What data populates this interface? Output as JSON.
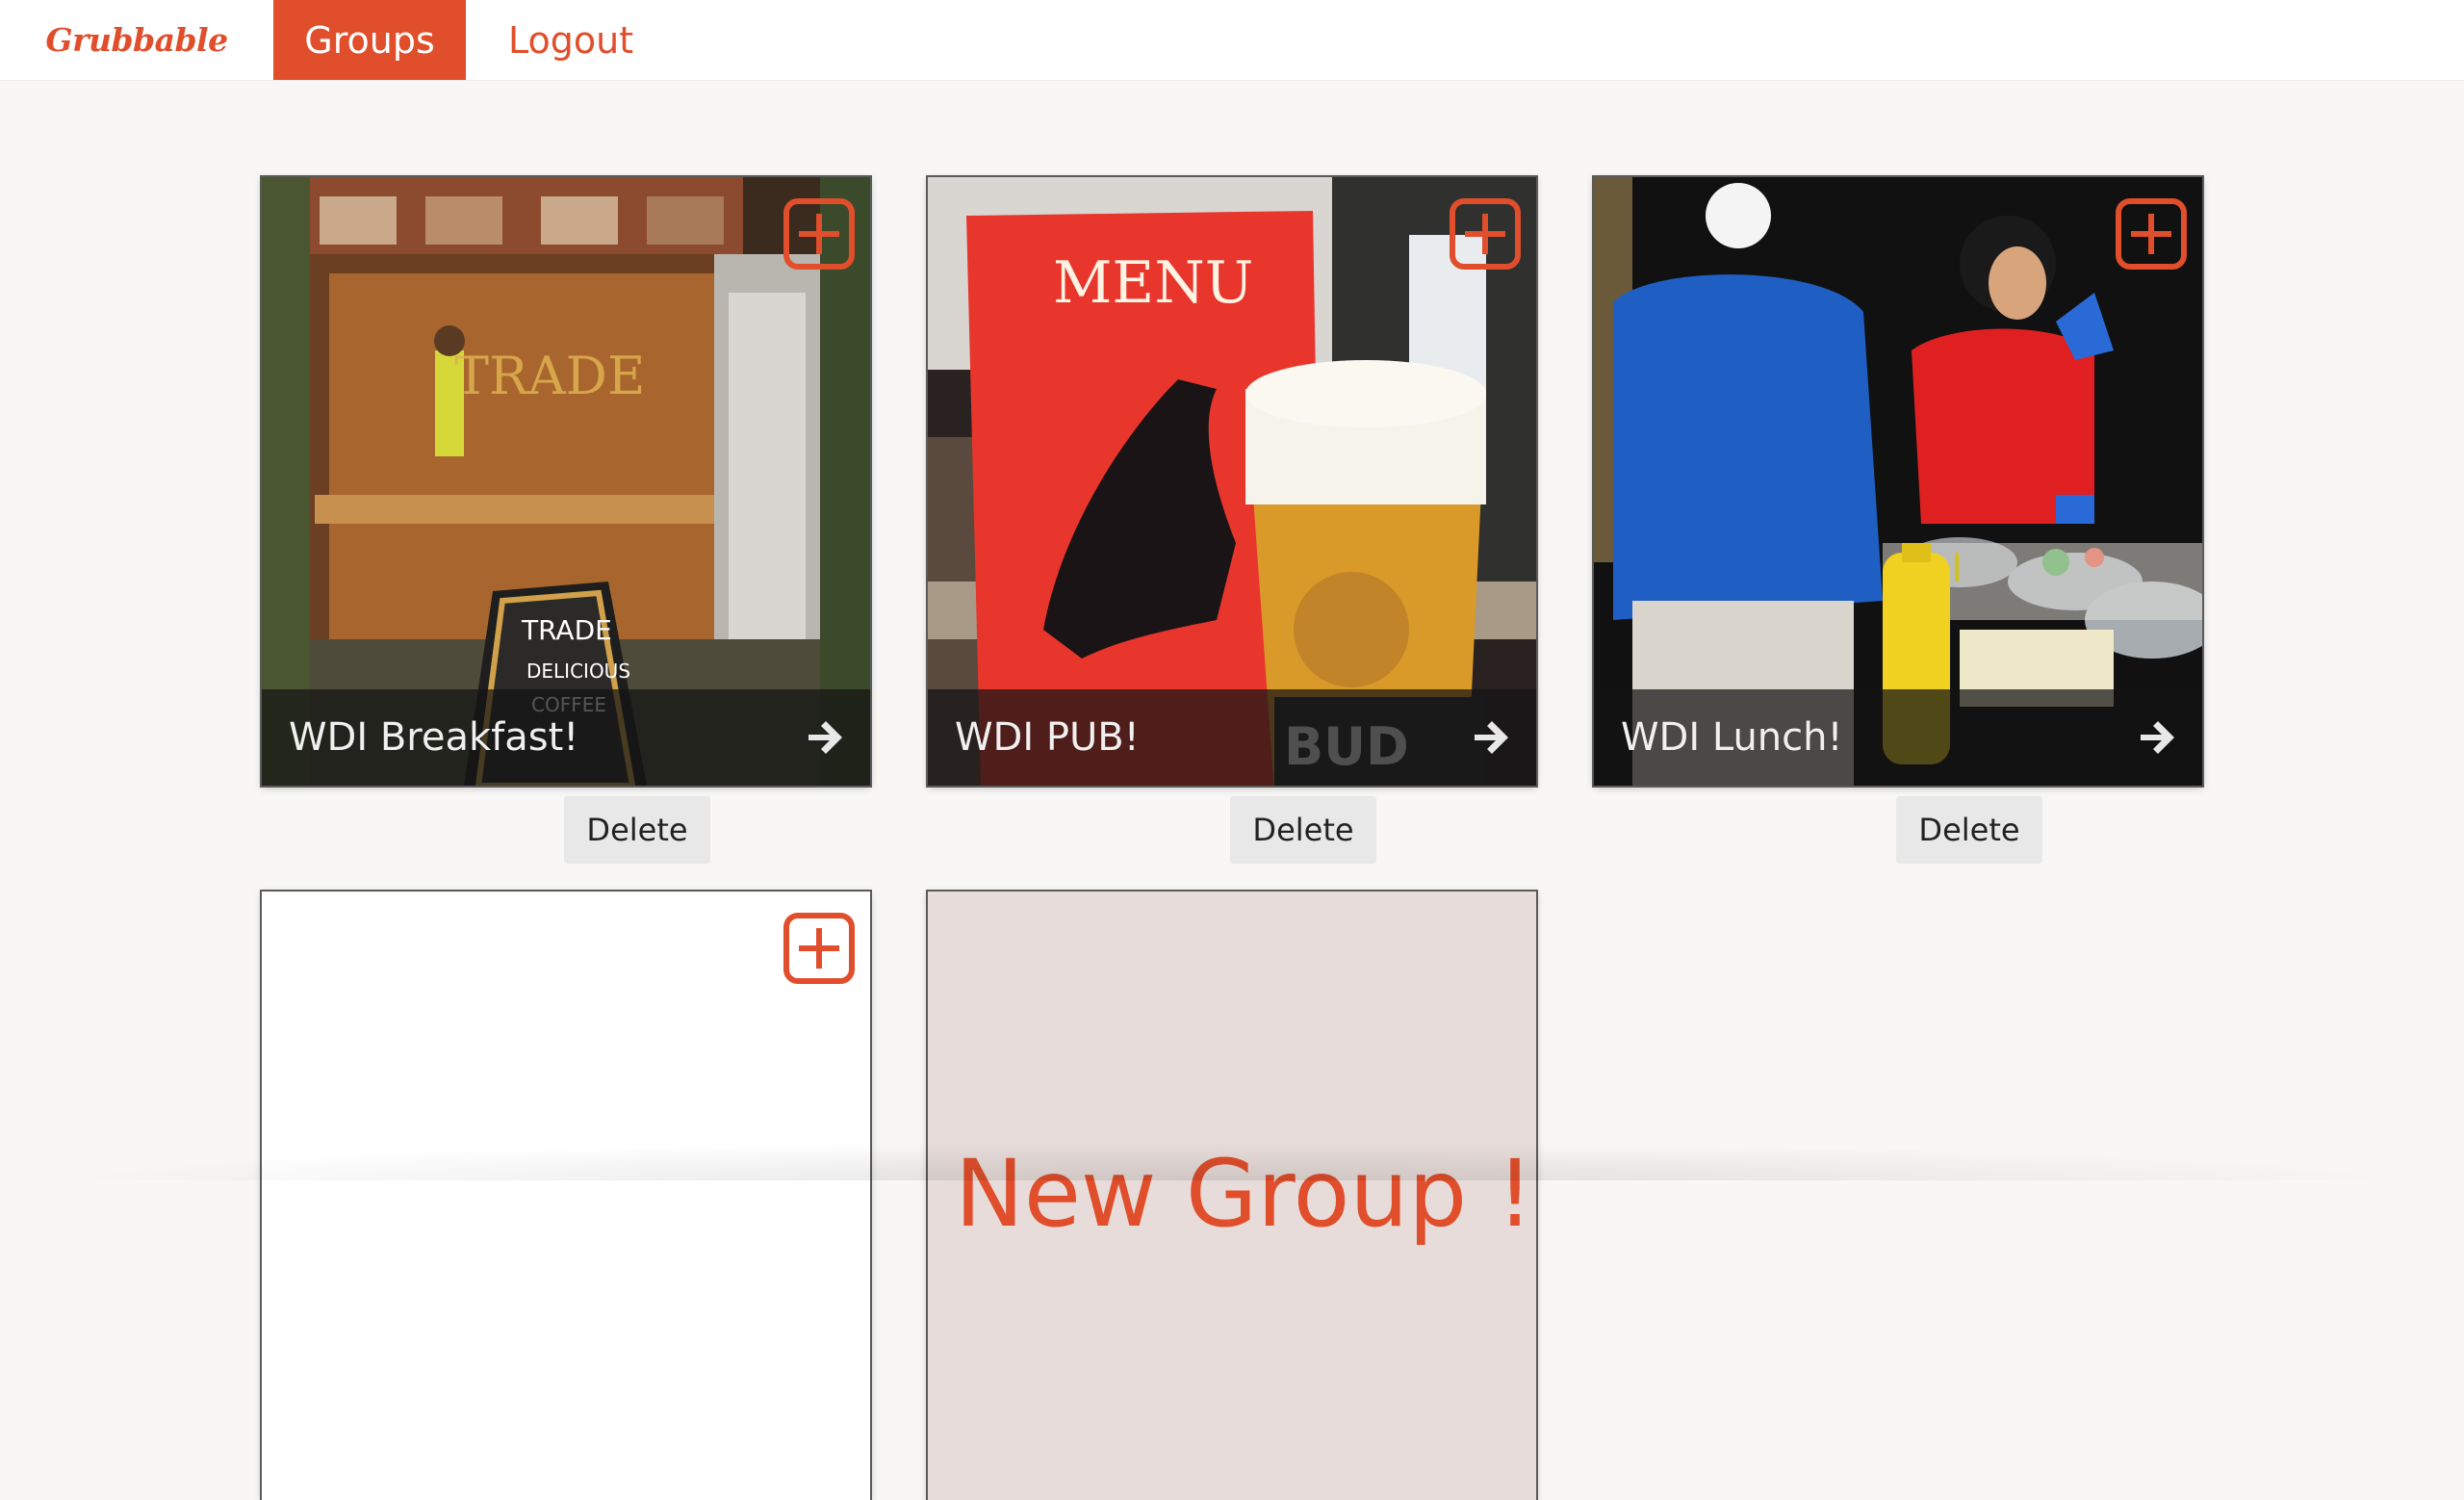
{
  "nav": {
    "brand": "Grubbable",
    "groups_label": "Groups",
    "logout_label": "Logout"
  },
  "cards": [
    {
      "title": "WDI Breakfast!",
      "delete_label": "Delete"
    },
    {
      "title": "WDI PUB!",
      "delete_label": "Delete"
    },
    {
      "title": "WDI Lunch!",
      "delete_label": "Delete"
    }
  ],
  "new_group": {
    "label": "New Group !"
  },
  "colors": {
    "accent": "#e04e2b",
    "background": "#f8f7f5",
    "new_group_card": "#e7dcd9"
  }
}
